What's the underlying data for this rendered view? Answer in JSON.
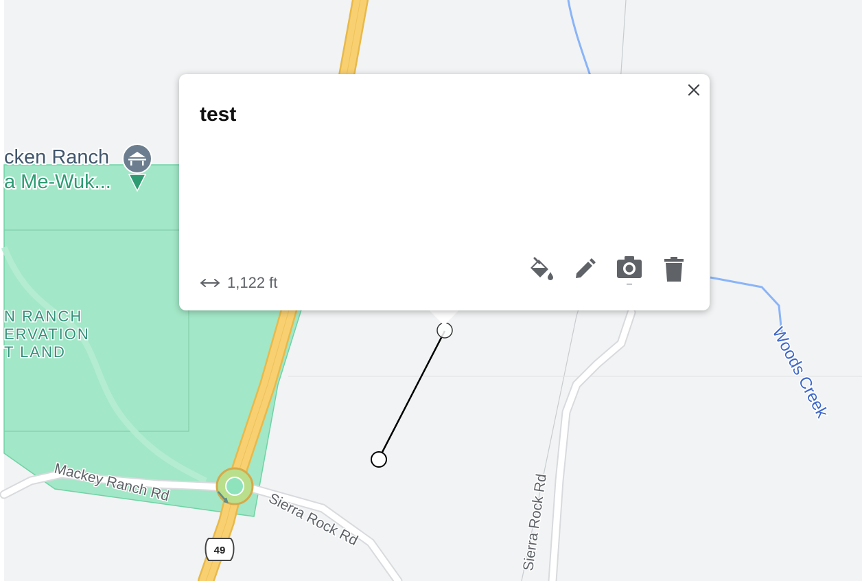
{
  "map": {
    "place_labels": {
      "ranch_line1": "cken Ranch",
      "ranch_line2": "a Me-Wuk...",
      "rancheria_line1": "N RANCH",
      "rancheria_line2": "ERVATION",
      "rancheria_line3": "T LAND"
    },
    "road_labels": {
      "mackey": "Mackey Ranch Rd",
      "sierra_rock_1": "Sierra Rock Rd",
      "sierra_rock_2": "Sierra Rock Rd",
      "highway_shield": "49"
    },
    "water_labels": {
      "creek": "Woods Creek"
    },
    "colors": {
      "land": "#f1f3f4",
      "reservation": "#8fe3bc",
      "highway": "#f8d071",
      "water": "#8ab4f8",
      "measured_line": "#000000"
    }
  },
  "popup": {
    "title": "test",
    "measurement": "1,122 ft",
    "icons": {
      "close": "close-icon",
      "measure": "arrow-left-right-icon",
      "style": "paint-bucket-icon",
      "edit": "pencil-icon",
      "photo": "camera-icon",
      "delete": "trash-icon"
    }
  }
}
